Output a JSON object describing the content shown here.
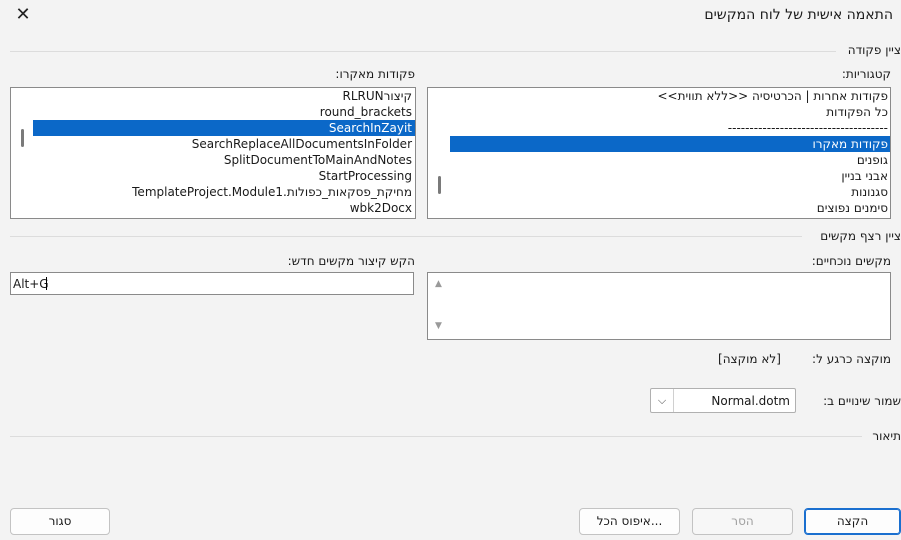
{
  "window": {
    "title": "התאמה אישית של לוח המקשים",
    "close_glyph": "✕"
  },
  "specify_command": {
    "group_label": "ציין פקודה",
    "categories_label": "קטגוריות:",
    "categories": [
      {
        "text": "פקודות אחרות | הכרטיסיה <<ללא תווית>>",
        "selected": false
      },
      {
        "text": "כל הפקודות",
        "selected": false
      },
      {
        "text": "-------------------------------------",
        "selected": false
      },
      {
        "text": "פקודות מאקרו",
        "selected": true
      },
      {
        "text": "גופנים",
        "selected": false
      },
      {
        "text": "אבני בניין",
        "selected": false
      },
      {
        "text": "סגנונות",
        "selected": false
      },
      {
        "text": "סימנים נפוצים",
        "selected": false
      }
    ],
    "macros_label": "פקודות מאקרו:",
    "macros": [
      {
        "text": "RLRUNקיצור",
        "selected": false
      },
      {
        "text": "round_brackets",
        "selected": false
      },
      {
        "text": "SearchInZayit",
        "selected": true
      },
      {
        "text": "SearchReplaceAllDocumentsInFolder",
        "selected": false
      },
      {
        "text": "SplitDocumentToMainAndNotes",
        "selected": false
      },
      {
        "text": "StartProcessing",
        "selected": false
      },
      {
        "text": "TemplateProject.Module1.מחיקת_פסקאות_כפולות",
        "selected": false
      },
      {
        "text": "wbk2Docx",
        "selected": false
      }
    ]
  },
  "shortcut": {
    "group_label": "ציין רצף מקשים",
    "current_keys_label": "מקשים נוכחיים:",
    "current_keys": [],
    "new_shortcut_label": "הקש קיצור מקשים חדש:",
    "new_shortcut_value": "Alt+G",
    "assigned_label": "מוקצה כרגע ל:",
    "assigned_value": "[לא מוקצה]",
    "save_in_label": "שמור שינויים ב:",
    "save_in_value": "Normal.dotm"
  },
  "description": {
    "group_label": "תיאור"
  },
  "buttons": {
    "assign": "הקצה",
    "remove": "הסר",
    "reset_all": "איפוס הכל...",
    "close": "סגור"
  }
}
